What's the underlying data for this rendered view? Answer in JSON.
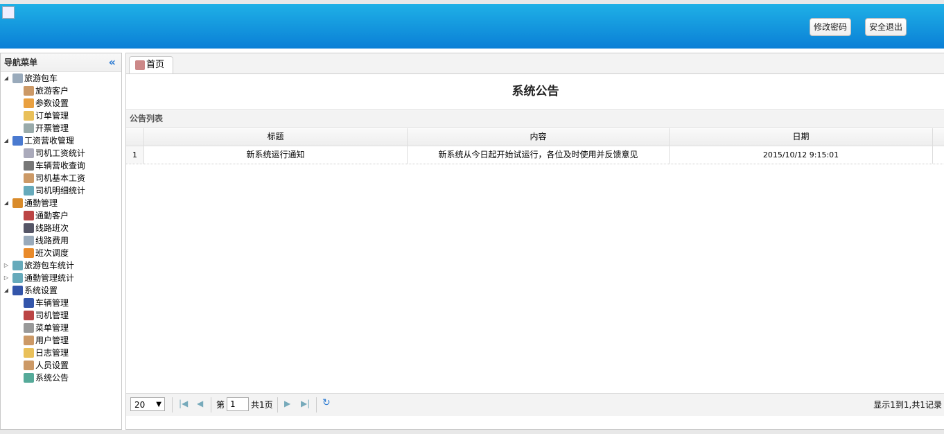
{
  "header": {
    "change_password": "修改密码",
    "logout": "安全退出"
  },
  "sidebar": {
    "title": "导航菜单",
    "collapse_glyph": "«",
    "items": [
      {
        "label": "旅游包车",
        "level": 0,
        "toggle": "◢",
        "icon": "bus-icon",
        "color": "#9ab"
      },
      {
        "label": "旅游客户",
        "level": 1,
        "icon": "users-icon",
        "color": "#c96"
      },
      {
        "label": "参数设置",
        "level": 1,
        "icon": "box-icon",
        "color": "#e9a040"
      },
      {
        "label": "订单管理",
        "level": 1,
        "icon": "edit-icon",
        "color": "#e9c05a"
      },
      {
        "label": "开票管理",
        "level": 1,
        "icon": "hourglass-icon",
        "color": "#9aa"
      },
      {
        "label": "工资营收管理",
        "level": 0,
        "toggle": "◢",
        "icon": "font-icon",
        "color": "#4a7ad0"
      },
      {
        "label": "司机工资统计",
        "level": 1,
        "icon": "building-icon",
        "color": "#aab"
      },
      {
        "label": "车辆营收查询",
        "level": 1,
        "icon": "printer-icon",
        "color": "#777"
      },
      {
        "label": "司机基本工资",
        "level": 1,
        "icon": "users-icon",
        "color": "#c96"
      },
      {
        "label": "司机明细统计",
        "level": 1,
        "icon": "chart-icon",
        "color": "#6ab"
      },
      {
        "label": "通勤管理",
        "level": 0,
        "toggle": "◢",
        "icon": "bus-icon",
        "color": "#d98b2a"
      },
      {
        "label": "通勤客户",
        "level": 1,
        "icon": "contact-icon",
        "color": "#b44"
      },
      {
        "label": "线路班次",
        "level": 1,
        "icon": "binoculars-icon",
        "color": "#556"
      },
      {
        "label": "线路费用",
        "level": 1,
        "icon": "bus-icon",
        "color": "#9ab"
      },
      {
        "label": "班次调度",
        "level": 1,
        "icon": "rss-icon",
        "color": "#e98a2a"
      },
      {
        "label": "旅游包车统计",
        "level": 0,
        "toggle": "▷",
        "icon": "chart-icon",
        "color": "#6ab"
      },
      {
        "label": "通勤管理统计",
        "level": 0,
        "toggle": "▷",
        "icon": "chart-icon",
        "color": "#6ab"
      },
      {
        "label": "系统设置",
        "level": 0,
        "toggle": "◢",
        "icon": "monitor-icon",
        "color": "#35a"
      },
      {
        "label": "车辆管理",
        "level": 1,
        "icon": "monitor-icon",
        "color": "#35a"
      },
      {
        "label": "司机管理",
        "level": 1,
        "icon": "contact-icon",
        "color": "#b44"
      },
      {
        "label": "菜单管理",
        "level": 1,
        "icon": "list-icon",
        "color": "#999"
      },
      {
        "label": "用户管理",
        "level": 1,
        "icon": "users-icon",
        "color": "#c96"
      },
      {
        "label": "日志管理",
        "level": 1,
        "icon": "edit-icon",
        "color": "#e9c05a"
      },
      {
        "label": "人员设置",
        "level": 1,
        "icon": "users-icon",
        "color": "#c96"
      },
      {
        "label": "系统公告",
        "level": 1,
        "icon": "grid-icon",
        "color": "#5a9"
      }
    ]
  },
  "tabs": [
    {
      "label": "首页"
    }
  ],
  "notice": {
    "title": "系统公告",
    "list_title": "公告列表",
    "columns": [
      "标题",
      "内容",
      "日期"
    ],
    "rows": [
      {
        "num": "1",
        "title": "新系统运行通知",
        "content": "新系统从今日起开始试运行，各位及时使用并反馈意见",
        "date": "2015/10/12 9:15:01"
      }
    ]
  },
  "pager": {
    "page_size": "20",
    "page_prefix": "第",
    "page": "1",
    "page_total": "共1页",
    "summary": "显示1到1,共1记录"
  }
}
